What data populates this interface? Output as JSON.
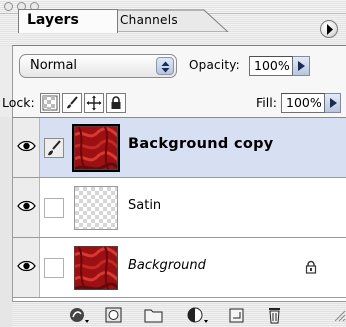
{
  "tabs": [
    {
      "label": "Layers",
      "active": true
    },
    {
      "label": "Channels",
      "active": false
    }
  ],
  "blend_mode": {
    "value": "Normal"
  },
  "opacity": {
    "label": "Opacity:",
    "value": "100%"
  },
  "lock": {
    "label": "Lock:"
  },
  "fill": {
    "label": "Fill:",
    "value": "100%"
  },
  "layers": [
    {
      "name": "Background copy",
      "visible": true,
      "selected": true,
      "style": "bold",
      "brush": true,
      "thumbnail": "red-texture"
    },
    {
      "name": "Satin",
      "visible": true,
      "selected": false,
      "style": "normal",
      "brush": false,
      "thumbnail": "transparent"
    },
    {
      "name": "Background",
      "visible": true,
      "selected": false,
      "style": "italic",
      "brush": false,
      "locked": true,
      "thumbnail": "red-texture"
    }
  ],
  "colors": {
    "selected_row": "#d7e0f2",
    "accent": "#b8c6de",
    "texture": "#a01010"
  },
  "bottom_buttons": [
    "layer-style-icon",
    "layer-mask-icon",
    "new-group-icon",
    "adjustment-layer-icon",
    "new-layer-icon",
    "trash-icon"
  ]
}
